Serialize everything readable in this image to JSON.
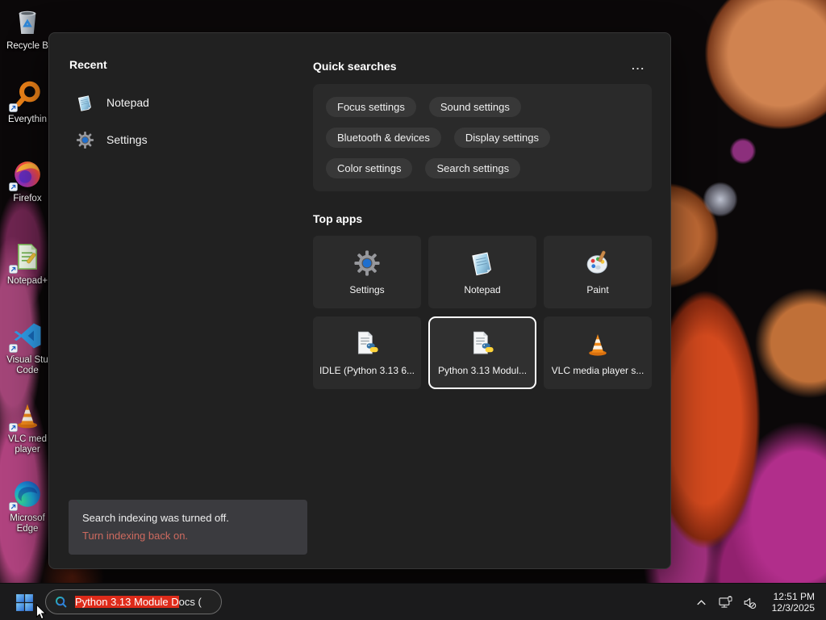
{
  "desktop_icons": [
    {
      "id": "recycle-bin",
      "lines": [
        "Recycle B",
        ""
      ]
    },
    {
      "id": "everything",
      "lines": [
        "Everythin",
        ""
      ]
    },
    {
      "id": "firefox",
      "lines": [
        "Firefox",
        ""
      ]
    },
    {
      "id": "notepad-plus-plus",
      "lines": [
        "Notepad+",
        ""
      ]
    },
    {
      "id": "visual-studio-code",
      "lines": [
        "Visual Stu",
        "Code"
      ]
    },
    {
      "id": "vlc-media-player",
      "lines": [
        "VLC med",
        "player"
      ]
    },
    {
      "id": "microsoft-edge",
      "lines": [
        "Microsof",
        "Edge"
      ]
    }
  ],
  "search_panel": {
    "recent": {
      "heading": "Recent",
      "items": [
        {
          "label": "Notepad"
        },
        {
          "label": "Settings"
        }
      ]
    },
    "quick_searches": {
      "heading": "Quick searches",
      "more_button": "...",
      "pills": [
        "Focus settings",
        "Sound settings",
        "Bluetooth & devices",
        "Display settings",
        "Color settings",
        "Search settings"
      ]
    },
    "top_apps": {
      "heading": "Top apps",
      "tiles": [
        {
          "label": "Settings",
          "selected": false
        },
        {
          "label": "Notepad",
          "selected": false
        },
        {
          "label": "Paint",
          "selected": false
        },
        {
          "label": "IDLE (Python 3.13 6...",
          "selected": false
        },
        {
          "label": "Python 3.13 Modul...",
          "selected": true
        },
        {
          "label": "VLC media player s...",
          "selected": false
        }
      ]
    },
    "indexing_notice": {
      "message": "Search indexing was turned off.",
      "link_text": "Turn indexing back on."
    }
  },
  "taskbar": {
    "search_box": {
      "highlighted_text": "Python 3.13 Module D",
      "trailing_text": "ocs ("
    },
    "tray": {
      "time": "12:51 PM",
      "date": "12/3/2025"
    }
  },
  "colors": {
    "selection_highlight": "#de2b1a",
    "notice_link": "#cd6a5f",
    "tile_selected_border": "#ffffff",
    "panel_background": "#212121",
    "taskbar_background": "#1b1b1c"
  }
}
